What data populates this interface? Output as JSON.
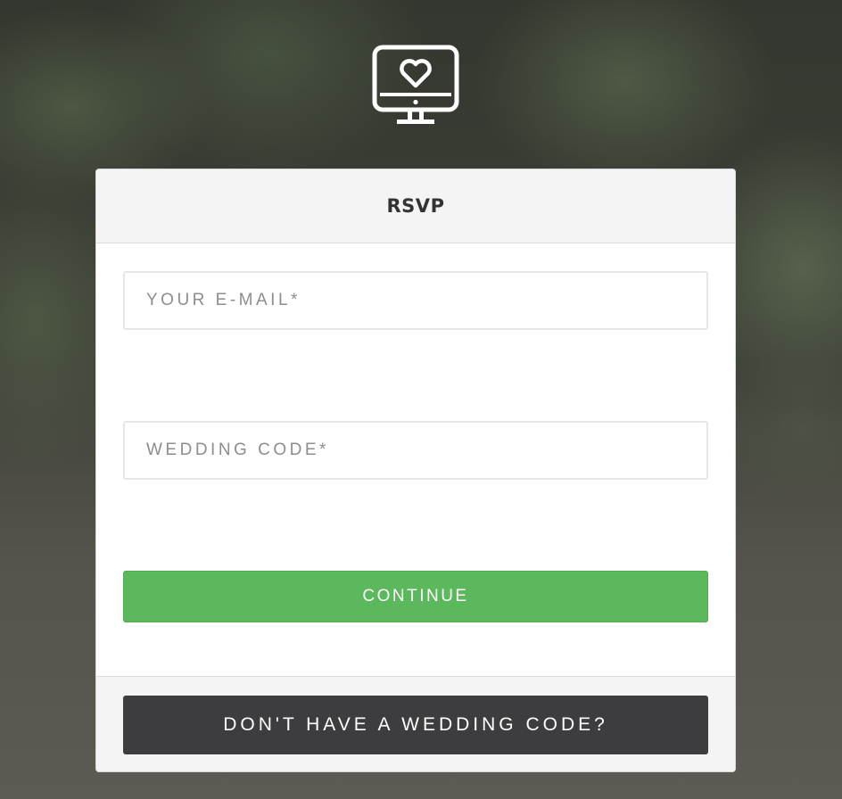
{
  "card": {
    "title": "RSVP"
  },
  "form": {
    "email_placeholder": "YOUR E-MAIL*",
    "email_value": "",
    "code_placeholder": "WEDDING CODE*",
    "code_value": ""
  },
  "buttons": {
    "continue_label": "CONTINUE",
    "no_code_label": "DON'T HAVE A WEDDING CODE?"
  },
  "icons": {
    "logo": "monitor-heart-icon"
  },
  "colors": {
    "continue_bg": "#5cb85c",
    "no_code_bg": "#3d3d3f",
    "header_bg": "#f4f4f4"
  }
}
